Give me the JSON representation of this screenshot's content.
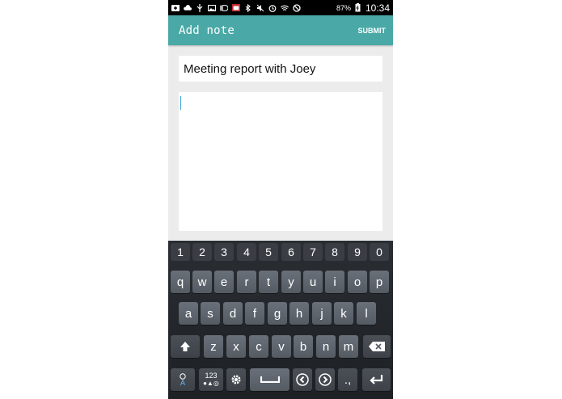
{
  "status_bar": {
    "battery": "87%",
    "time": "10:34",
    "icons": [
      "add-icon",
      "cloud-icon",
      "usb-icon",
      "image-icon",
      "id-icon",
      "calendar-icon",
      "bluetooth-icon",
      "mute-icon",
      "alarm-icon",
      "wifi-icon",
      "block-icon",
      "battery-icon"
    ]
  },
  "action_bar": {
    "title": "Add note",
    "submit_label": "SUBMIT",
    "color": "#4aa9a7"
  },
  "note": {
    "title_value": "Meeting report with Joey",
    "body_value": ""
  },
  "keyboard": {
    "number_row": [
      "1",
      "2",
      "3",
      "4",
      "5",
      "6",
      "7",
      "8",
      "9",
      "0"
    ],
    "row1": [
      "q",
      "w",
      "e",
      "r",
      "t",
      "y",
      "u",
      "i",
      "o",
      "p"
    ],
    "row2": [
      "a",
      "s",
      "d",
      "f",
      "g",
      "h",
      "j",
      "k",
      "l"
    ],
    "row3": [
      "z",
      "x",
      "c",
      "v",
      "b",
      "n",
      "m"
    ],
    "mode_top": "123",
    "mode_bottom": "●▲◎",
    "punct_key": ".,",
    "lang_key": "A"
  }
}
